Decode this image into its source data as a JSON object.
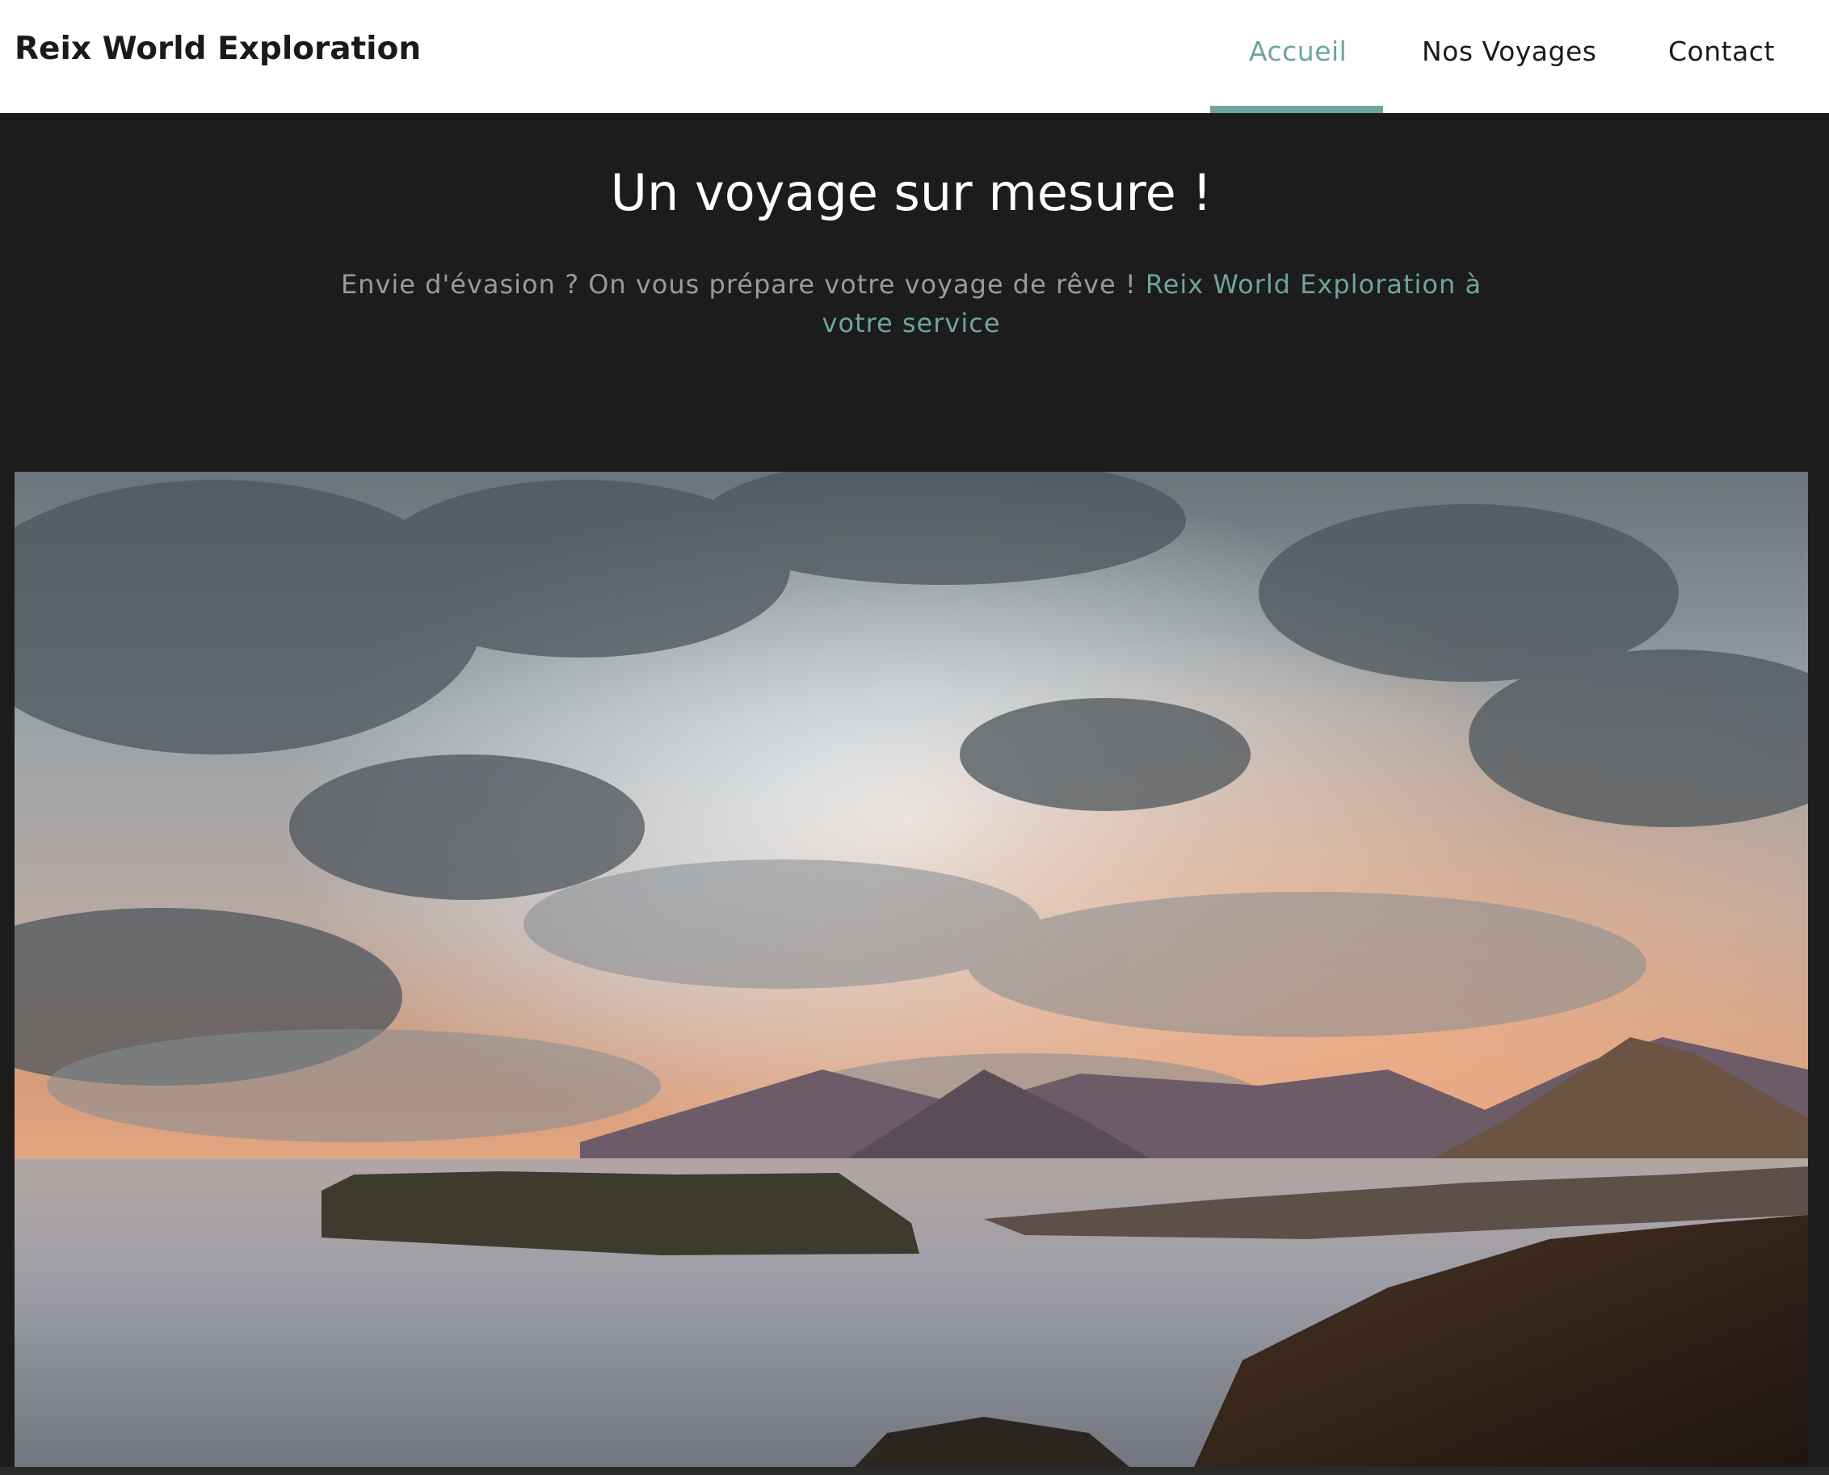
{
  "navbar": {
    "brand": "Reix World Exploration",
    "links": [
      {
        "label": "Accueil",
        "active": true
      },
      {
        "label": "Nos Voyages",
        "active": false
      },
      {
        "label": "Contact",
        "active": false
      }
    ]
  },
  "hero": {
    "title": "Un voyage sur mesure !",
    "text_intro": "Envie d'évasion ? On vous prépare votre voyage de rêve ! ",
    "text_accent": "Reix World Exploration à votre service"
  },
  "colors": {
    "accent": "#6fa39f",
    "background_dark": "#1c1c1c",
    "navbar_bg": "#ffffff"
  }
}
